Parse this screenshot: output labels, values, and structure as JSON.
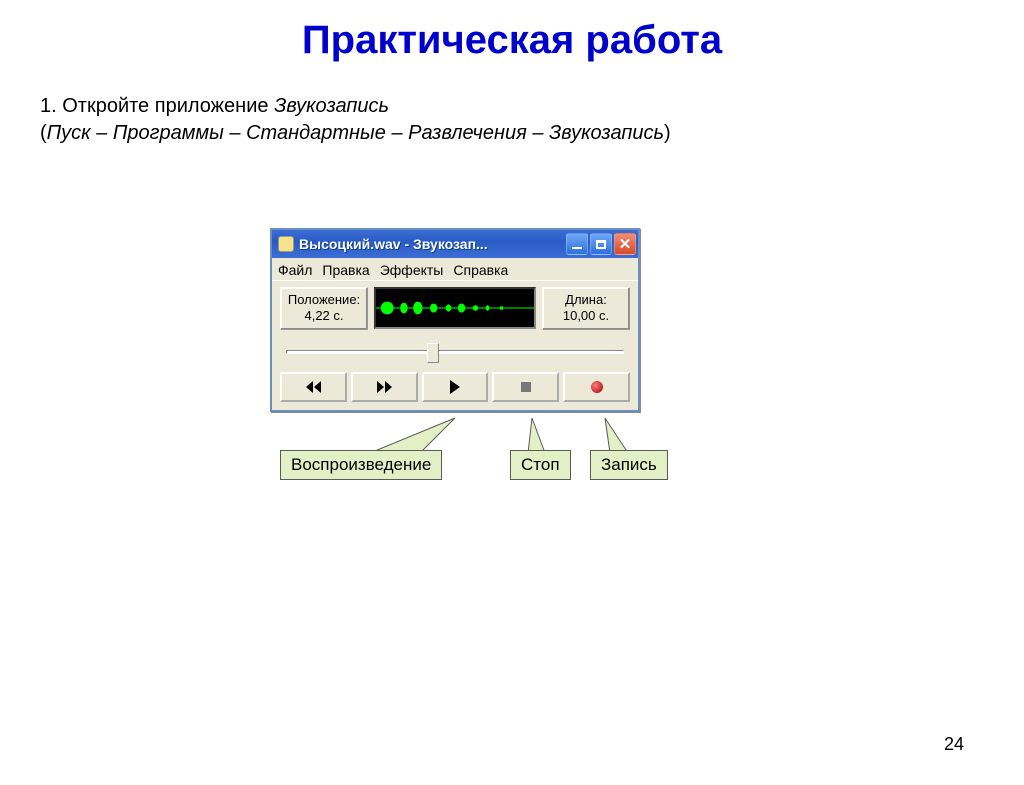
{
  "slide": {
    "title": "Практическая работа",
    "instruction_line1_a": "1. Откройте приложение ",
    "instruction_line1_b": "Звукозапись",
    "instruction_line2_a": "(",
    "instruction_line2_b": "Пуск – Программы – Стандартные – Развлечения – Звукозапись",
    "instruction_line2_c": ")",
    "page_number": "24"
  },
  "window": {
    "title": "Высоцкий.wav - Звукозап...",
    "menu": {
      "file": "Файл",
      "edit": "Правка",
      "effects": "Эффекты",
      "help": "Справка"
    },
    "position": {
      "label": "Положение:",
      "value": "4,22 с."
    },
    "length": {
      "label": "Длина:",
      "value": "10,00 с."
    }
  },
  "callouts": {
    "play": "Воспроизведение",
    "stop": "Стоп",
    "record": "Запись"
  }
}
